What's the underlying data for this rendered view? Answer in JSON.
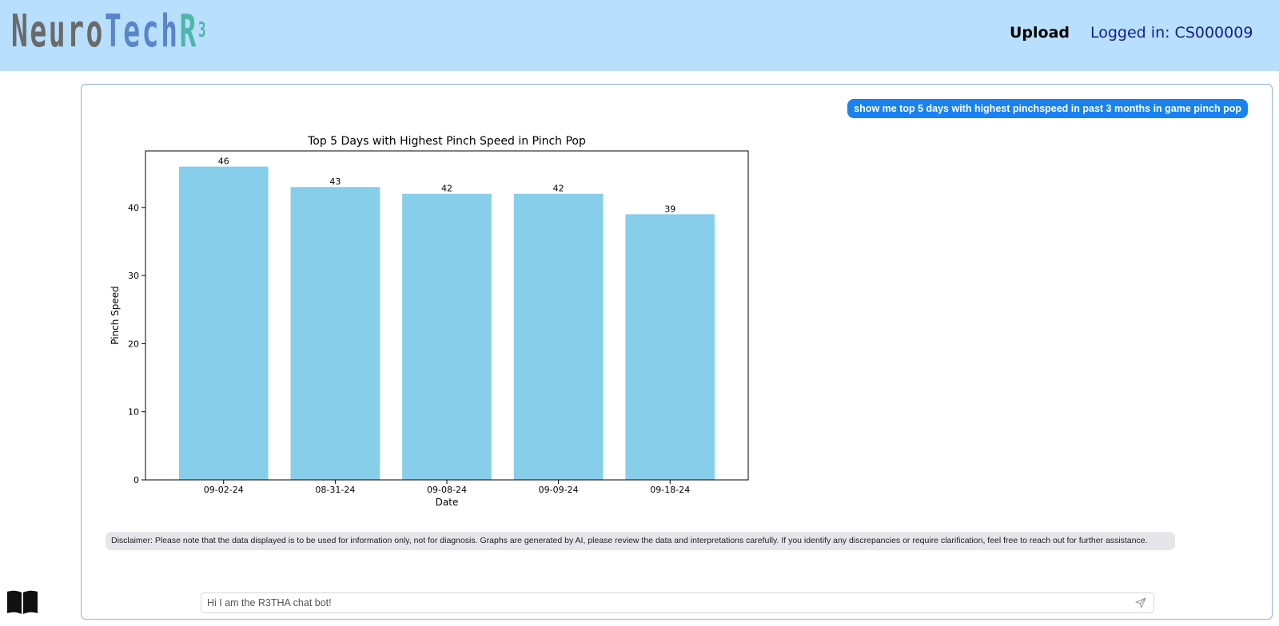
{
  "header": {
    "logo": {
      "part1": "Neuro",
      "part2": "Tech",
      "part3": "R",
      "superscript": "3"
    },
    "upload_label": "Upload",
    "login_label": "Logged in: CS000009",
    "background": "#b8dffe"
  },
  "chat": {
    "user_message": "show me top 5 days with highest pinchspeed in past 3 months in game pinch pop",
    "disclaimer": "Disclaimer: Please note that the data displayed is to be used for information only, not for diagnosis. Graphs are generated by AI, please review the data and interpretations carefully. If you identify any discrepancies or require clarification, feel free to reach out for further assistance.",
    "input_placeholder": "Hi I am the R3THA chat bot!",
    "send_icon": "send-icon"
  },
  "sidebar": {
    "book_icon": "book-icon"
  },
  "chart_data": {
    "type": "bar",
    "title": "Top 5 Days with Highest Pinch Speed in Pinch Pop",
    "xlabel": "Date",
    "ylabel": "Pinch Speed",
    "categories": [
      "09-02-24",
      "08-31-24",
      "09-08-24",
      "09-09-24",
      "09-18-24"
    ],
    "values": [
      46,
      43,
      42,
      42,
      39
    ],
    "data_labels": [
      "46",
      "43",
      "42",
      "42",
      "39"
    ],
    "ylim": [
      0,
      48.3
    ],
    "yticks": [
      0,
      10,
      20,
      30,
      40
    ],
    "bar_color": "#87ceeb",
    "grid": false,
    "legend": "none"
  }
}
